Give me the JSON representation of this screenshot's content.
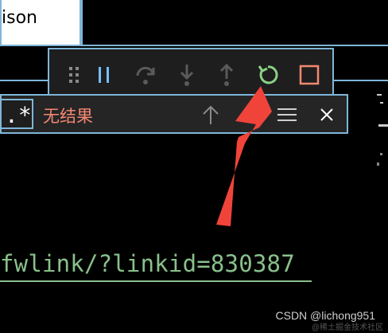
{
  "editor": {
    "title_fragment": "ison",
    "link_text": "fwlink/?linkid=830387"
  },
  "find_widget": {
    "regex_glyph": ".*",
    "status_text": "无结果",
    "status_color": "#f48771"
  },
  "debug_toolbar": {
    "buttons": [
      {
        "icon": "drag-gripper-icon"
      },
      {
        "icon": "pause-icon",
        "color": "#75beff"
      },
      {
        "icon": "step-over-icon"
      },
      {
        "icon": "step-into-icon"
      },
      {
        "icon": "step-out-icon"
      },
      {
        "icon": "restart-icon",
        "color": "#89d185"
      },
      {
        "icon": "stop-icon",
        "color": "#f48771"
      }
    ]
  },
  "watermark": {
    "text": "CSDN @lichong951",
    "subtext": "@稀土掘金技术社区"
  },
  "colors": {
    "accent_border": "#7fb6d8",
    "annotation_arrow": "#f0443a"
  }
}
